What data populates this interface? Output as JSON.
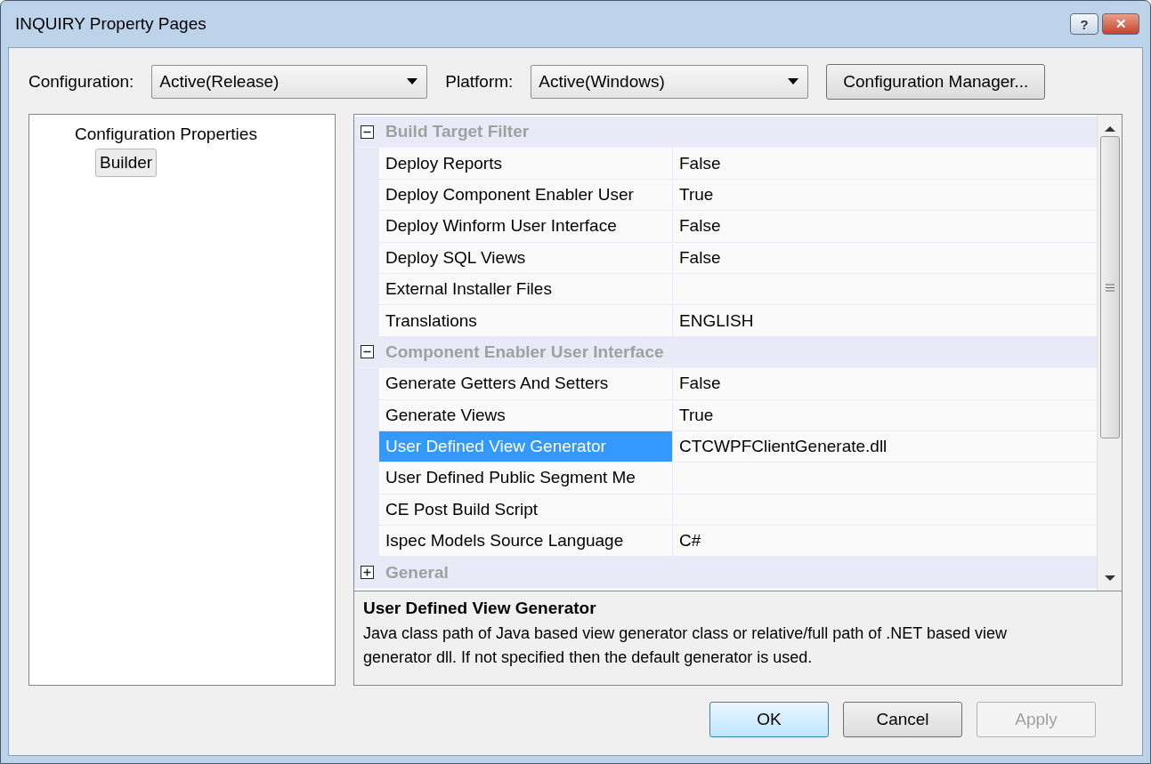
{
  "window": {
    "title": "INQUIRY Property Pages",
    "title_buttons": [
      "?",
      "✕"
    ]
  },
  "toolbar": {
    "configuration": {
      "label": "Configuration:",
      "value": "Active(Release)"
    },
    "platform": {
      "label": "Platform:",
      "value": "Active(Windows)"
    },
    "manager_button": "Configuration Manager..."
  },
  "tree": [
    {
      "label": "Configuration Properties",
      "selected": false,
      "children": [
        {
          "label": "Builder",
          "selected": true
        }
      ]
    }
  ],
  "property_grid": {
    "categories": [
      {
        "name": "Build Target Filter",
        "expanded": true,
        "rows": [
          {
            "name": "Deploy Reports",
            "value": "False",
            "selected": false
          },
          {
            "name": "Deploy Component Enabler User",
            "value": "True",
            "selected": false
          },
          {
            "name": "Deploy Winform User Interface",
            "value": "False",
            "selected": false
          },
          {
            "name": "Deploy SQL Views",
            "value": "False",
            "selected": false
          },
          {
            "name": "External Installer Files",
            "selected": false
          },
          {
            "name": "Translations",
            "value": "ENGLISH",
            "selected": false
          }
        ]
      },
      {
        "name": "Component Enabler User Interface",
        "expanded": true,
        "rows": [
          {
            "name": "Generate Getters And Setters",
            "value": "False",
            "selected": false
          },
          {
            "name": "Generate Views",
            "value": "True",
            "selected": false
          },
          {
            "name": "User Defined View Generator",
            "value": "CTCWPFClientGenerate.dll",
            "selected": true
          },
          {
            "name": "User Defined Public Segment Me",
            "selected": false
          },
          {
            "name": "CE Post Build Script",
            "selected": false
          },
          {
            "name": "Ispec Models Source Language",
            "value": "C#",
            "selected": false
          }
        ]
      },
      {
        "name": "General",
        "expanded": false
      }
    ]
  },
  "description": {
    "title": "User Defined View Generator",
    "text": "Java class path of Java based view generator class or relative/full path of .NET based view generator dll. If not specified then the default generator is used."
  },
  "buttons": [
    {
      "label": "OK",
      "default": true,
      "disabled": false
    },
    {
      "label": "Cancel",
      "default": false,
      "disabled": false
    },
    {
      "label": "Apply",
      "default": false,
      "disabled": true
    }
  ]
}
